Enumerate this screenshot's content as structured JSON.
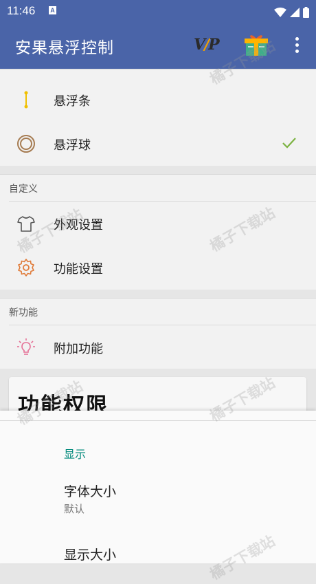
{
  "status_bar": {
    "time": "11:46",
    "notification_glyph": "A"
  },
  "app_bar": {
    "title": "安果悬浮控制",
    "vip_prefix": "V",
    "vip_slash": "/",
    "vip_suffix": "P"
  },
  "mode_list": [
    {
      "label": "悬浮条",
      "icon": "vertical-line-icon",
      "selected": false
    },
    {
      "label": "悬浮球",
      "icon": "ring-icon",
      "selected": true
    }
  ],
  "custom_section": {
    "header": "自定义",
    "items": [
      {
        "label": "外观设置",
        "icon": "tshirt-icon"
      },
      {
        "label": "功能设置",
        "icon": "gear-icon"
      }
    ]
  },
  "new_section": {
    "header": "新功能",
    "items": [
      {
        "label": "附加功能",
        "icon": "lightbulb-icon"
      }
    ]
  },
  "permission_card": {
    "title": "功能权限"
  },
  "display_sheet": {
    "header": "显示",
    "prefs": [
      {
        "title": "字体大小",
        "summary": "默认"
      },
      {
        "title": "显示大小",
        "summary": ""
      }
    ]
  },
  "watermark_text": "橘子下载站",
  "colors": {
    "primary": "#4a64a8",
    "accent_teal": "#00897b",
    "check_green": "#7cb342",
    "gear_orange": "#e07b39",
    "bulb_pink": "#e57398"
  }
}
